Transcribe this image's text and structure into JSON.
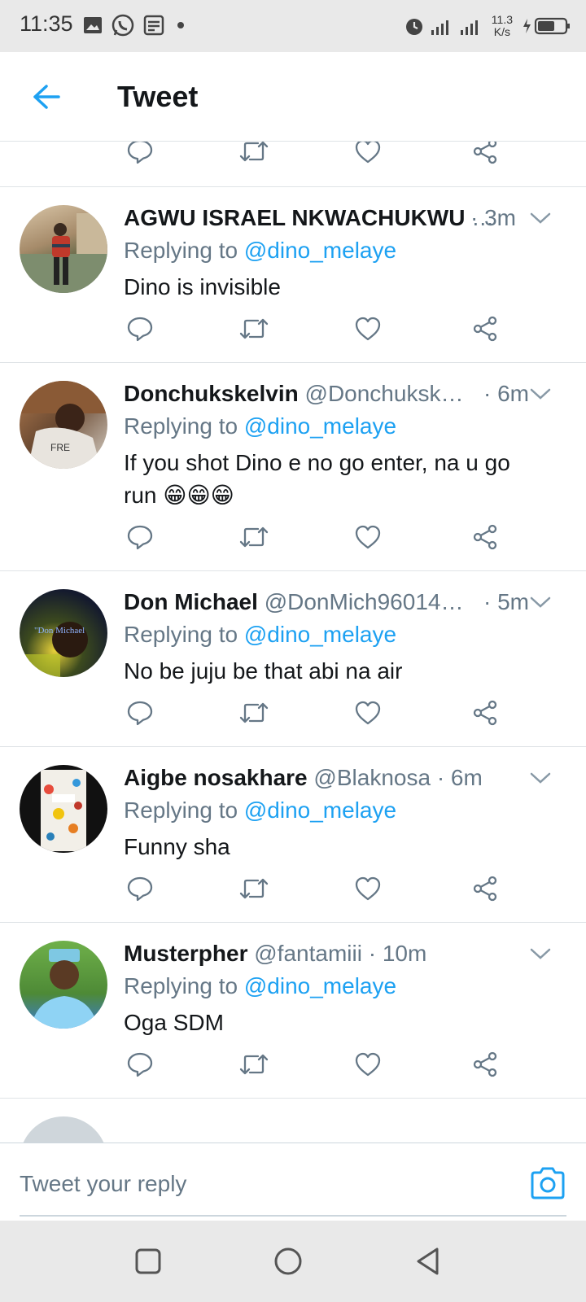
{
  "status_bar": {
    "time": "11:35",
    "net_speed_value": "11.3",
    "net_speed_unit": "K/s",
    "left_icons": [
      "image-icon",
      "whatsapp-icon",
      "news-icon",
      "dot-icon"
    ],
    "right_icons": [
      "alarm-icon",
      "signal-icon",
      "signal-4g-icon",
      "battery-charging-icon"
    ]
  },
  "header": {
    "title": "Tweet",
    "back_icon": "back-arrow-icon"
  },
  "tweets": [
    {
      "name": "AGWU ISRAEL NKWACHUKWU",
      "handle": "…",
      "time": "· 3m",
      "replying_prefix": "Replying to ",
      "replying_to": "@dino_melaye",
      "text": "Dino is invisible"
    },
    {
      "name": "Donchukskelvin",
      "handle": "@Donchuksk…",
      "time": "· 6m",
      "replying_prefix": "Replying to ",
      "replying_to": "@dino_melaye",
      "text": "If you shot Dino e no go enter, na u go run 😁😁😁"
    },
    {
      "name": "Don Michael",
      "handle": "@DonMich96014…",
      "time": "· 5m",
      "replying_prefix": "Replying to ",
      "replying_to": "@dino_melaye",
      "text": "No be juju be that abi na air"
    },
    {
      "name": "Aigbe nosakhare",
      "handle": "@Blaknosa",
      "time": "· 6m",
      "replying_prefix": "Replying to ",
      "replying_to": "@dino_melaye",
      "text": "Funny sha"
    },
    {
      "name": "Musterpher",
      "handle": "@fantamiii",
      "time": "· 10m",
      "replying_prefix": "Replying to ",
      "replying_to": "@dino_melaye",
      "text": "Oga SDM"
    }
  ],
  "reply_bar": {
    "placeholder": "Tweet your reply",
    "camera_icon": "camera-icon"
  },
  "nav_bar": {
    "icons": [
      "recents-square-icon",
      "home-circle-icon",
      "back-triangle-icon"
    ]
  },
  "colors": {
    "accent": "#1da1f2",
    "text": "#14171a",
    "secondary": "#657786",
    "divider": "#dfe3e6",
    "system_bar": "#e9e9e9"
  }
}
